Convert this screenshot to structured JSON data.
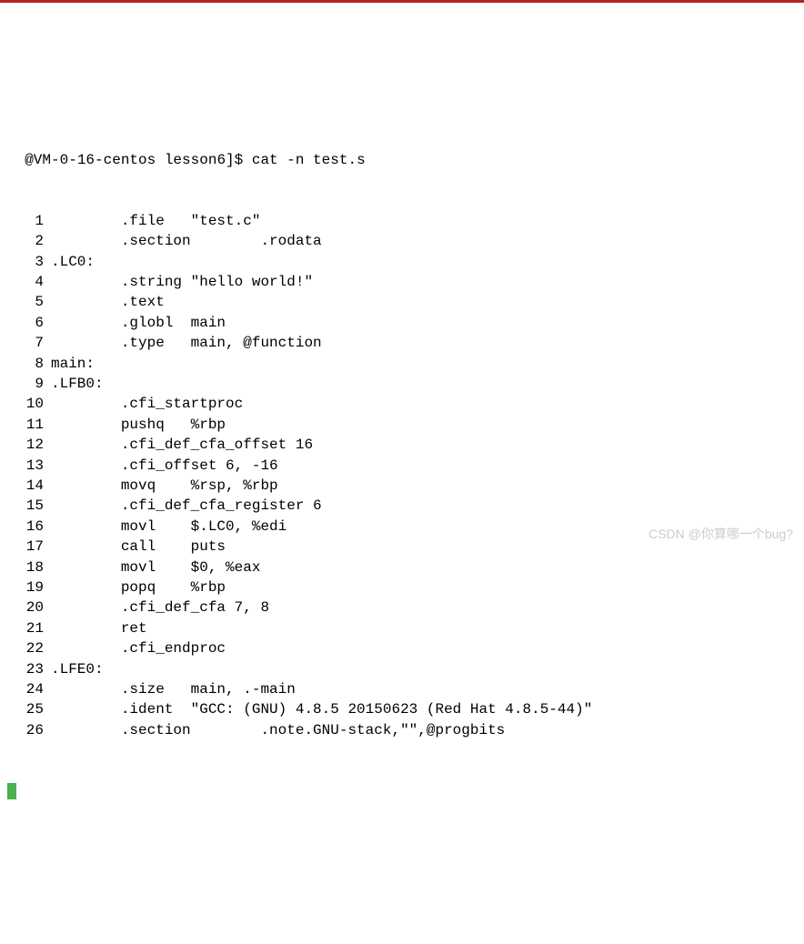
{
  "terminal": {
    "prompt": "@VM-0-16-centos lesson6]$ cat -n test.s",
    "watermark": "CSDN @你算哪一个bug?",
    "lines": [
      {
        "num": "1",
        "text": "        .file   \"test.c\""
      },
      {
        "num": "2",
        "text": "        .section        .rodata"
      },
      {
        "num": "3",
        "text": ".LC0:"
      },
      {
        "num": "4",
        "text": "        .string \"hello world!\""
      },
      {
        "num": "5",
        "text": "        .text"
      },
      {
        "num": "6",
        "text": "        .globl  main"
      },
      {
        "num": "7",
        "text": "        .type   main, @function"
      },
      {
        "num": "8",
        "text": "main:"
      },
      {
        "num": "9",
        "text": ".LFB0:"
      },
      {
        "num": "10",
        "text": "        .cfi_startproc"
      },
      {
        "num": "11",
        "text": "        pushq   %rbp"
      },
      {
        "num": "12",
        "text": "        .cfi_def_cfa_offset 16"
      },
      {
        "num": "13",
        "text": "        .cfi_offset 6, -16"
      },
      {
        "num": "14",
        "text": "        movq    %rsp, %rbp"
      },
      {
        "num": "15",
        "text": "        .cfi_def_cfa_register 6"
      },
      {
        "num": "16",
        "text": "        movl    $.LC0, %edi"
      },
      {
        "num": "17",
        "text": "        call    puts"
      },
      {
        "num": "18",
        "text": "        movl    $0, %eax"
      },
      {
        "num": "19",
        "text": "        popq    %rbp"
      },
      {
        "num": "20",
        "text": "        .cfi_def_cfa 7, 8"
      },
      {
        "num": "21",
        "text": "        ret"
      },
      {
        "num": "22",
        "text": "        .cfi_endproc"
      },
      {
        "num": "23",
        "text": ".LFE0:"
      },
      {
        "num": "24",
        "text": "        .size   main, .-main"
      },
      {
        "num": "25",
        "text": "        .ident  \"GCC: (GNU) 4.8.5 20150623 (Red Hat 4.8.5-44)\""
      },
      {
        "num": "26",
        "text": "        .section        .note.GNU-stack,\"\",@progbits"
      }
    ]
  }
}
